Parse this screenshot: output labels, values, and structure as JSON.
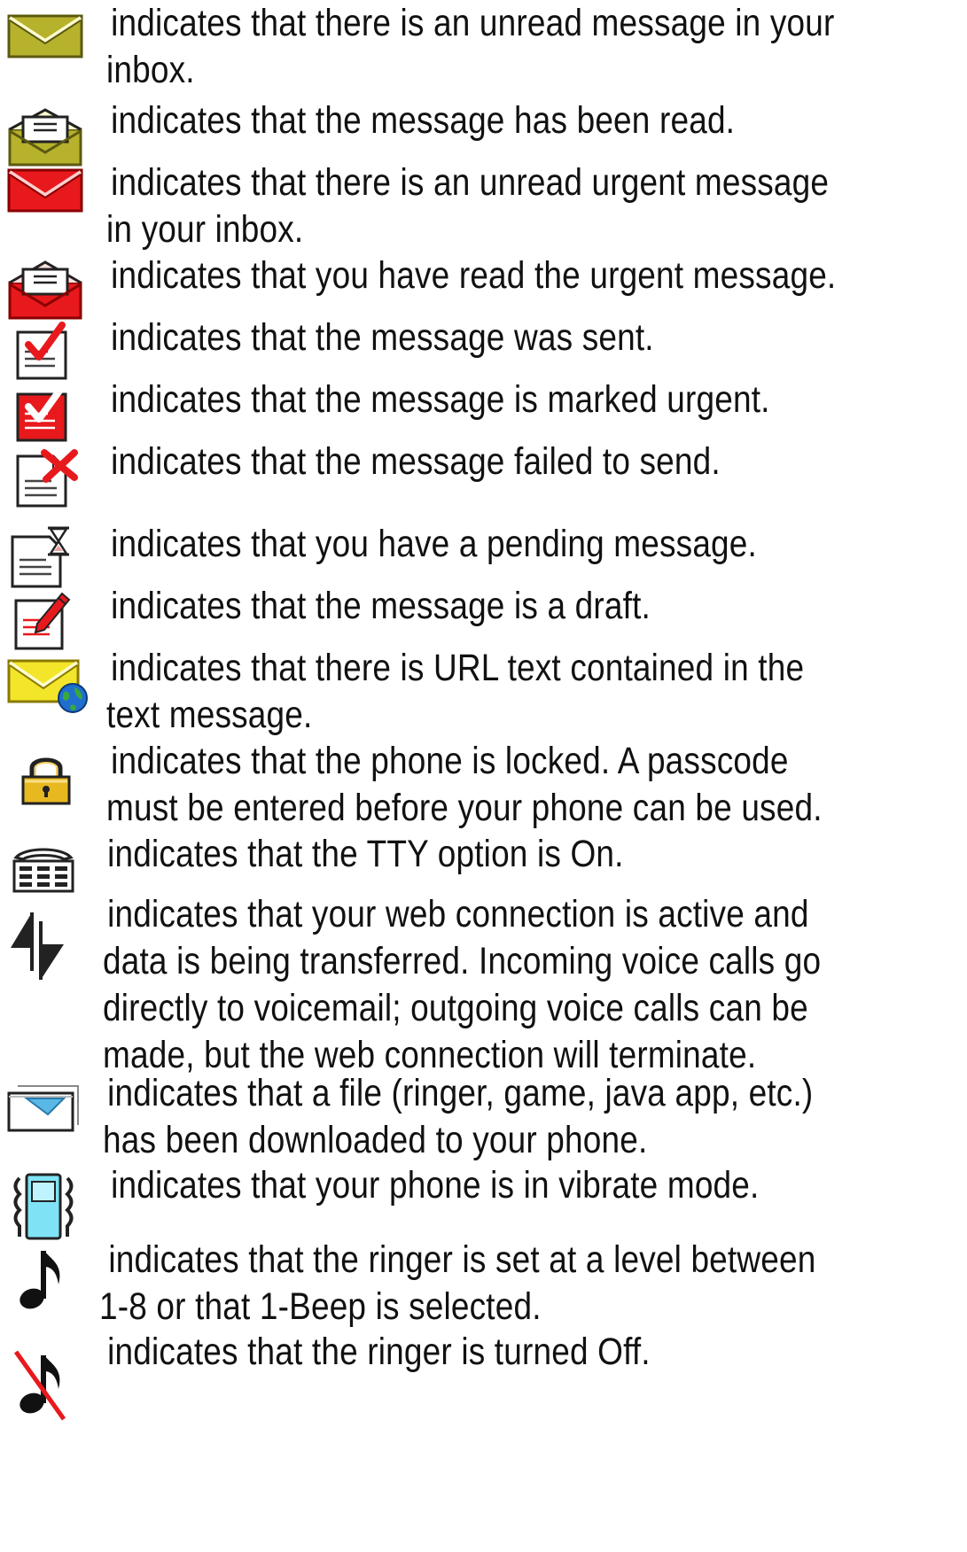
{
  "legend": {
    "items": [
      {
        "icon": "envelope-unread-icon",
        "text": "indicates that there is an unread message in your inbox."
      },
      {
        "icon": "envelope-read-icon",
        "text": "indicates that the message has been read."
      },
      {
        "icon": "envelope-urgent-unread-icon",
        "text": "indicates that there is an unread urgent message in your inbox."
      },
      {
        "icon": "envelope-urgent-read-icon",
        "text": "indicates that you have read the urgent message."
      },
      {
        "icon": "message-sent-icon",
        "text": "indicates that the message was sent."
      },
      {
        "icon": "message-urgent-icon",
        "text": "indicates that the message is marked urgent."
      },
      {
        "icon": "message-failed-icon",
        "text": "indicates that the message failed to send."
      },
      {
        "icon": "message-pending-icon",
        "text": "indicates that you have a pending message."
      },
      {
        "icon": "message-draft-icon",
        "text": "indicates that the message is a draft."
      },
      {
        "icon": "envelope-url-icon",
        "text": "indicates that there is URL text contained in the text message."
      },
      {
        "icon": "padlock-icon",
        "text": "indicates that the phone is locked. A passcode must be entered before your phone can be used."
      },
      {
        "icon": "tty-icon",
        "text": "indicates that the TTY option is On."
      },
      {
        "icon": "data-transfer-icon",
        "text": "indicates that your web connection is active and data is being transferred. Incoming voice calls go directly to voicemail; outgoing voice calls can be made, but the web connection will terminate."
      },
      {
        "icon": "download-icon",
        "text": "indicates that a file (ringer, game, java app, etc.) has been downloaded to your phone."
      },
      {
        "icon": "vibrate-icon",
        "text": "indicates that your phone is in vibrate mode."
      },
      {
        "icon": "ringer-on-icon",
        "text": "indicates that the ringer is set at a level between 1-8 or that 1-Beep is selected."
      },
      {
        "icon": "ringer-off-icon",
        "text": "indicates that the ringer is turned Off."
      }
    ]
  },
  "colors": {
    "envelope_olive": "#b7b22c",
    "envelope_red": "#e8191c",
    "envelope_yellow": "#f3e62a",
    "check_red": "#e8191c",
    "lock_gold": "#e8b820",
    "vibrate_cyan": "#7fe3f5",
    "download_blue": "#5ab8e6"
  }
}
